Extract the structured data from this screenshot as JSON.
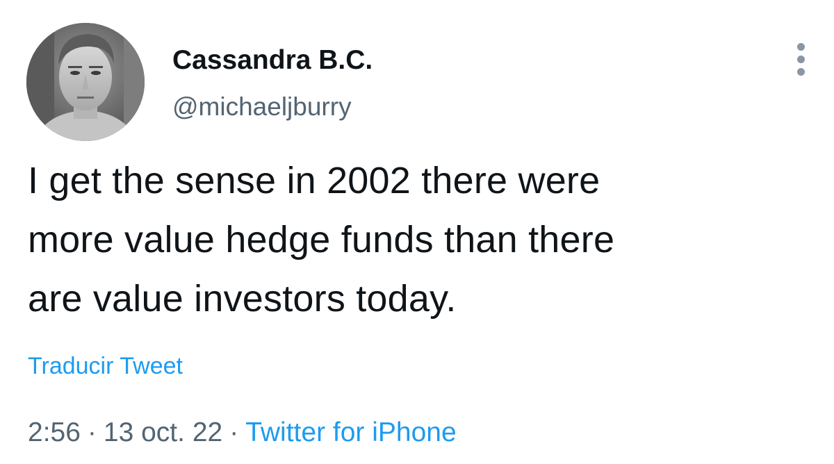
{
  "author": {
    "display_name": "Cassandra B.C.",
    "handle": "@michaeljburry",
    "avatar": "profile-photo"
  },
  "menu": {
    "icon": "more-vertical-icon"
  },
  "tweet": {
    "lines": [
      "I get the sense in 2002 there were",
      "more value hedge funds than there",
      "are value investors today."
    ],
    "translate_label": "Traducir Tweet"
  },
  "meta": {
    "time": "2:56",
    "separator": "·",
    "date": "13 oct. 22",
    "source": "Twitter for iPhone"
  },
  "colors": {
    "text": "#0f1419",
    "secondary": "#536471",
    "link": "#1d9bf0",
    "background": "#ffffff"
  }
}
